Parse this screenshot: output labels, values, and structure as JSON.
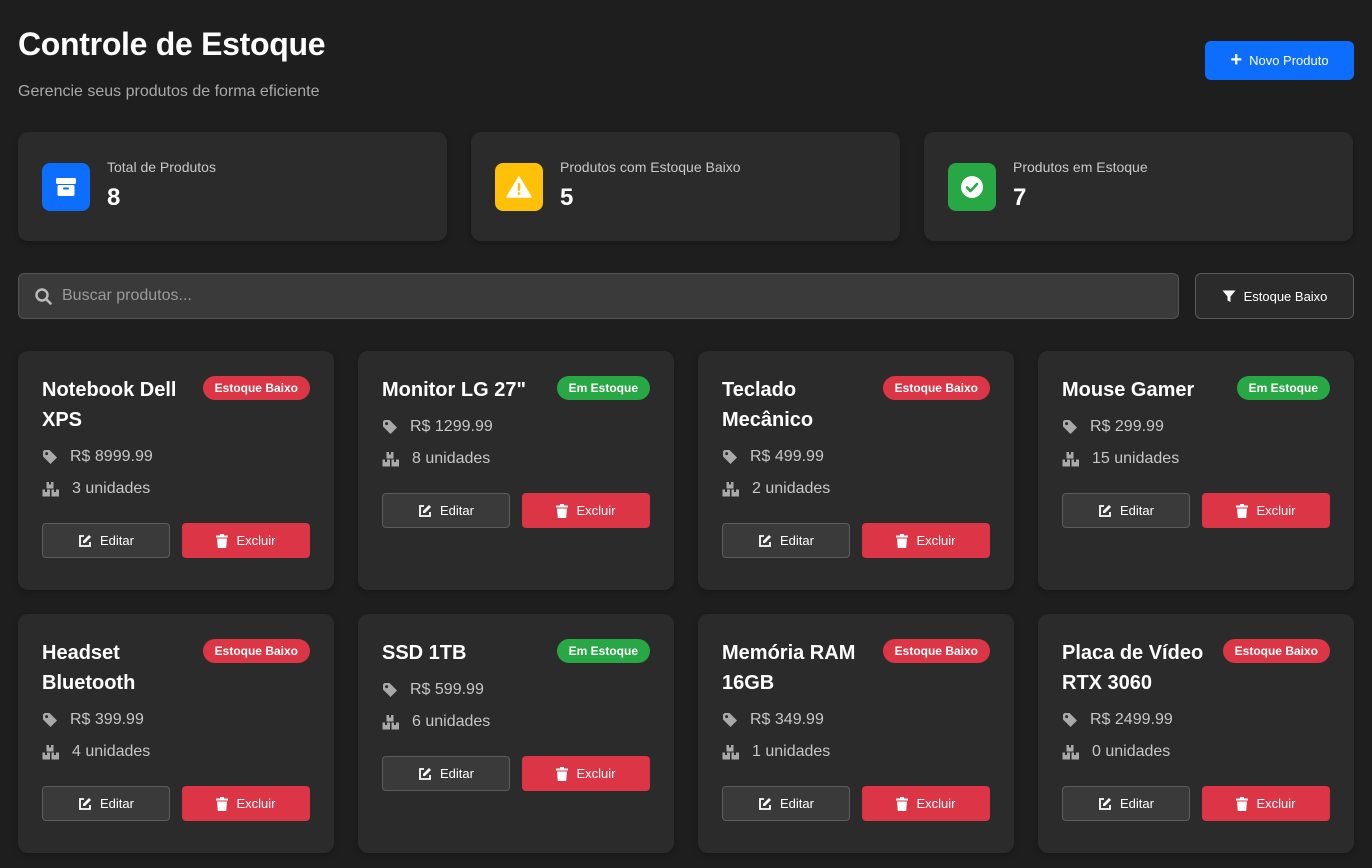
{
  "header": {
    "title": "Controle de Estoque",
    "subtitle": "Gerencie seus produtos de forma eficiente",
    "new_button": "Novo Produto"
  },
  "stats": [
    {
      "label": "Total de Produtos",
      "value": "8",
      "color": "#0d6efd",
      "icon": "box-icon"
    },
    {
      "label": "Produtos com Estoque Baixo",
      "value": "5",
      "color": "#ffc107",
      "icon": "warning-icon"
    },
    {
      "label": "Produtos em Estoque",
      "value": "7",
      "color": "#28a745",
      "icon": "check-circle-icon"
    }
  ],
  "search": {
    "placeholder": "Buscar produtos..."
  },
  "filter": {
    "label": "Estoque Baixo"
  },
  "actions": {
    "edit": "Editar",
    "delete": "Excluir"
  },
  "colors": {
    "primary": "#0d6efd",
    "danger": "#dc3545",
    "success": "#28a745",
    "warning": "#ffc107"
  },
  "products": [
    {
      "name": "Notebook Dell XPS",
      "status": "Estoque Baixo",
      "low": true,
      "price": "R$ 8999.99",
      "qty": "3 unidades"
    },
    {
      "name": "Monitor LG 27\"",
      "status": "Em Estoque",
      "low": false,
      "price": "R$ 1299.99",
      "qty": "8 unidades"
    },
    {
      "name": "Teclado Mecânico",
      "status": "Estoque Baixo",
      "low": true,
      "price": "R$ 499.99",
      "qty": "2 unidades"
    },
    {
      "name": "Mouse Gamer",
      "status": "Em Estoque",
      "low": false,
      "price": "R$ 299.99",
      "qty": "15 unidades"
    },
    {
      "name": "Headset Bluetooth",
      "status": "Estoque Baixo",
      "low": true,
      "price": "R$ 399.99",
      "qty": "4 unidades"
    },
    {
      "name": "SSD 1TB",
      "status": "Em Estoque",
      "low": false,
      "price": "R$ 599.99",
      "qty": "6 unidades"
    },
    {
      "name": "Memória RAM 16GB",
      "status": "Estoque Baixo",
      "low": true,
      "price": "R$ 349.99",
      "qty": "1 unidades"
    },
    {
      "name": "Placa de Vídeo RTX 3060",
      "status": "Estoque Baixo",
      "low": true,
      "price": "R$ 2499.99",
      "qty": "0 unidades"
    }
  ]
}
